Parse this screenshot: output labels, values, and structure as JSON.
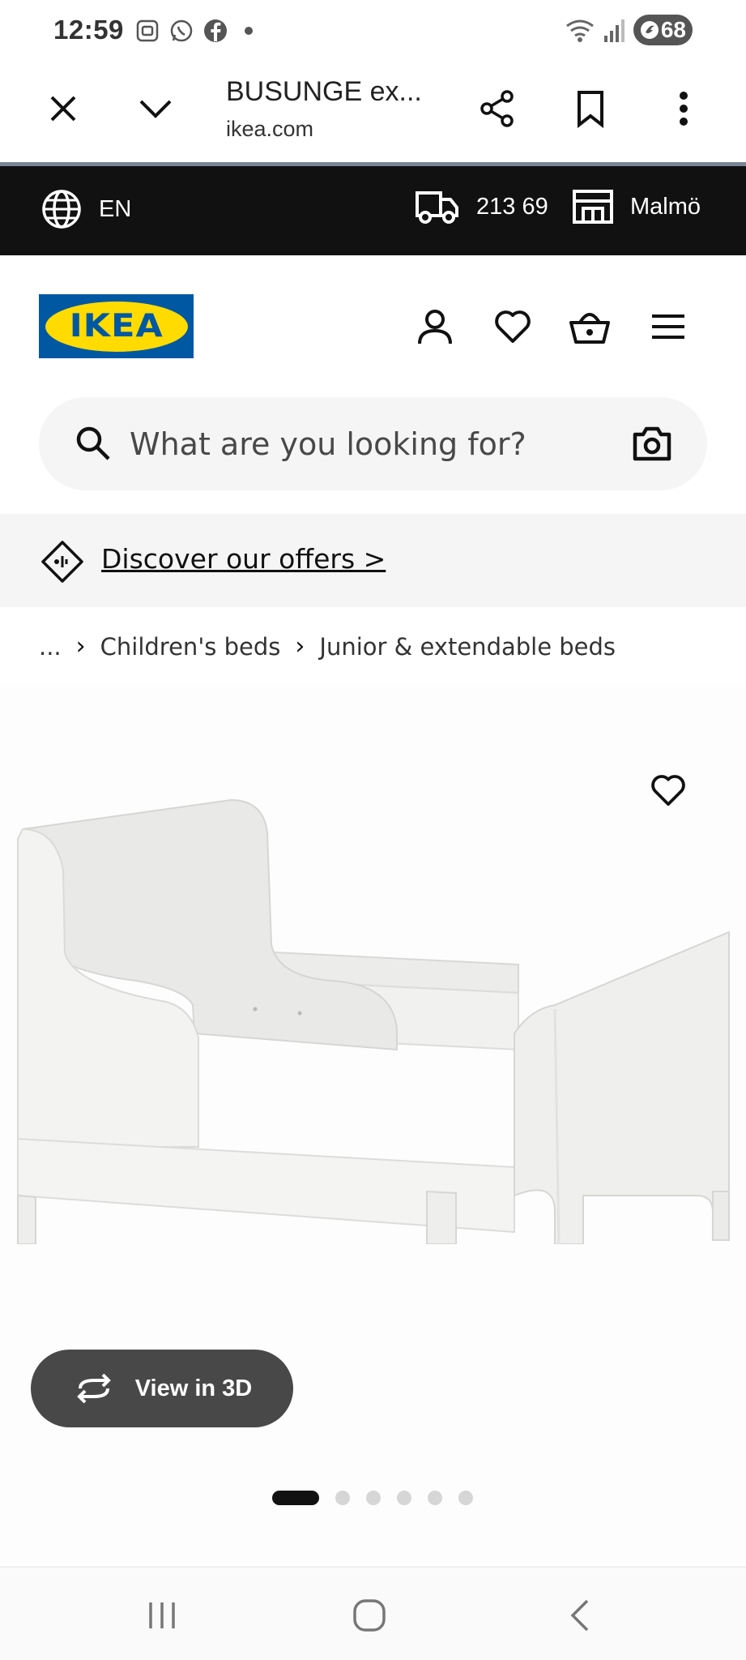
{
  "status_bar": {
    "time": "12:59",
    "battery": "68",
    "icons": [
      "screenshot-icon",
      "whatsapp-icon",
      "facebook-icon",
      "wifi-icon",
      "signal-icon"
    ]
  },
  "browser": {
    "title": "BUSUNGE ex...",
    "url": "ikea.com"
  },
  "top_bar": {
    "language": "EN",
    "postal_code": "213 69",
    "store": "Malmö"
  },
  "header": {
    "logo_text": "IKEA",
    "brand_colors": {
      "blue": "#0058a3",
      "yellow": "#ffdb00"
    }
  },
  "search": {
    "placeholder": "What are you looking for?"
  },
  "offers": {
    "link_text": "Discover our offers >"
  },
  "breadcrumb": {
    "ellipsis": "...",
    "items": [
      "Children's beds",
      "Junior & extendable beds"
    ]
  },
  "product": {
    "view_3d_label": "View in 3D",
    "image_count": 6,
    "active_image_index": 0
  }
}
